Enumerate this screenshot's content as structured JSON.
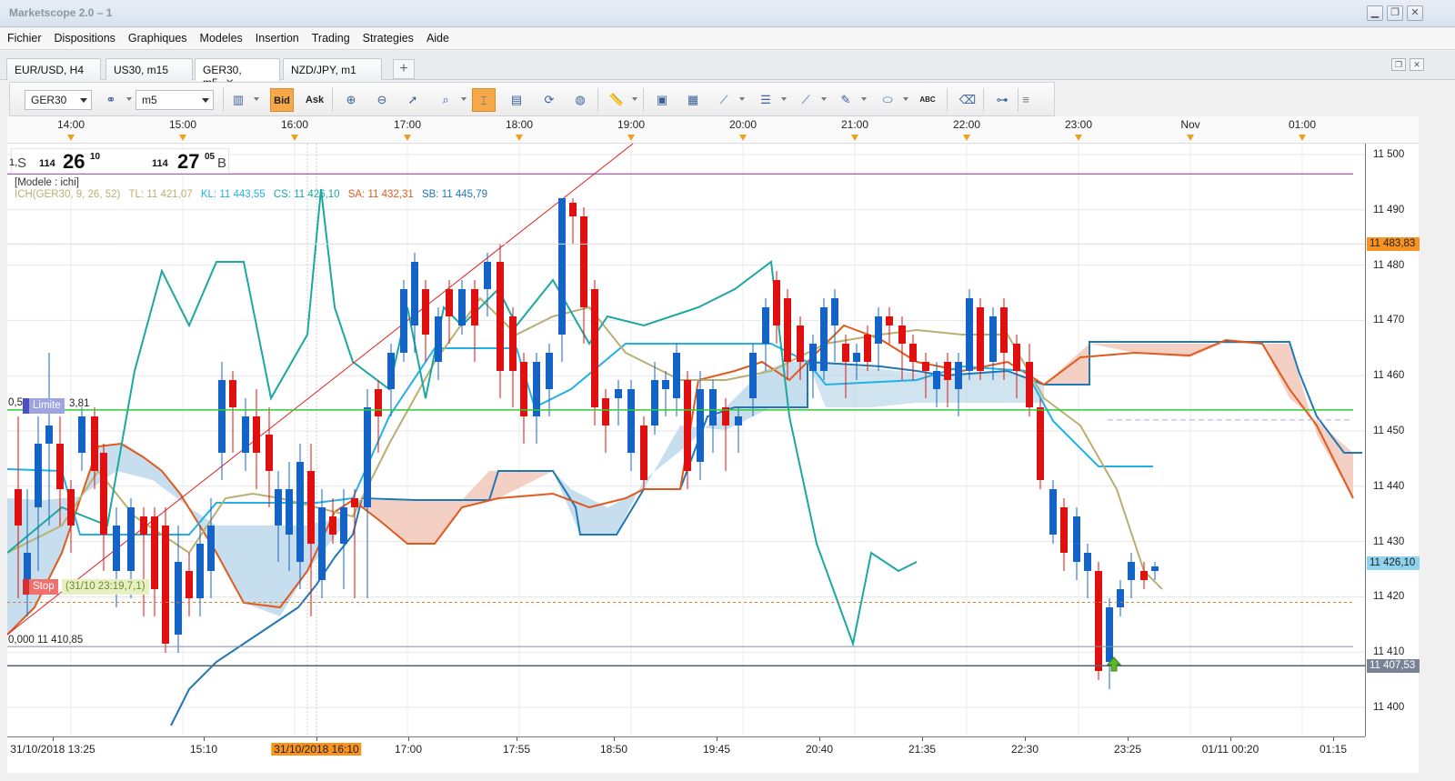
{
  "app": {
    "title": "Marketscope 2.0 – 1",
    "window_controls": [
      "minimize",
      "restore",
      "close"
    ]
  },
  "menu": [
    "Fichier",
    "Dispositions",
    "Graphiques",
    "Modeles",
    "Insertion",
    "Trading",
    "Strategies",
    "Aide"
  ],
  "tabs": [
    {
      "label": "EUR/USD, H4"
    },
    {
      "label": "US30, m15"
    },
    {
      "label": "GER30, m5",
      "close": "✕"
    },
    {
      "label": "NZD/JPY, m1"
    }
  ],
  "tab_add": "+",
  "toolbar": {
    "instrument": "GER30",
    "timeframe": "m5",
    "bid": "Bid",
    "ask": "Ask",
    "abc": "ABC"
  },
  "chart": {
    "top_times": [
      "14:00",
      "15:00",
      "16:00",
      "17:00",
      "18:00",
      "19:00",
      "20:00",
      "21:00",
      "22:00",
      "23:00",
      "Nov",
      "01:00"
    ],
    "y_ticks": [
      "11 500",
      "11 490",
      "11 480",
      "11 470",
      "11 460",
      "11 450",
      "11 440",
      "11 430",
      "11 420",
      "11 410",
      "11 400"
    ],
    "x_labels": [
      "31/10/2018 13:25",
      "15:10",
      "31/10/2018 16:10",
      "17:00",
      "17:55",
      "18:50",
      "19:45",
      "20:40",
      "21:35",
      "22:30",
      "23:25",
      "01/11 00:20",
      "01:15"
    ],
    "badges": {
      "upper": "11 483,83",
      "current": "11 426,10",
      "lower": "11 407,53"
    },
    "colors": {
      "bull": "#1464c8",
      "bear": "#e01010",
      "tenkan": "#b8b070",
      "kijun": "#22b0e6",
      "chikou": "#1aa8a0",
      "senkou_a": "#e05a1e",
      "senkou_b": "#1e78b4",
      "cloud_bull": "#bcd8ea",
      "cloud_bear": "#f2cbbd"
    }
  },
  "price_box": {
    "side_s": "S",
    "bid_small": "114",
    "bid_big": "26",
    "bid_sup": "10",
    "ask_small": "114",
    "ask_big": "27",
    "ask_sup": "05",
    "side_b": "B"
  },
  "legend": {
    "model": "[Modele : ichi]",
    "ich": "ICH(GER30, 9, 26, 52)",
    "tl": "TL: 11 421,07",
    "kl": "KL: 11 443,55",
    "cs": "CS: 11 426,10",
    "sa": "SA: 11 432,31",
    "sb": "SB: 11 445,79"
  },
  "annotations": {
    "fib_left_top": "1,",
    "fib_half": "0,5",
    "limit": "Limite",
    "limit_val": "3,81",
    "stop": "Stop",
    "stop_note": "(31/10 23:19,7,1)",
    "fib_zero": "0,000 11 410,85"
  }
}
